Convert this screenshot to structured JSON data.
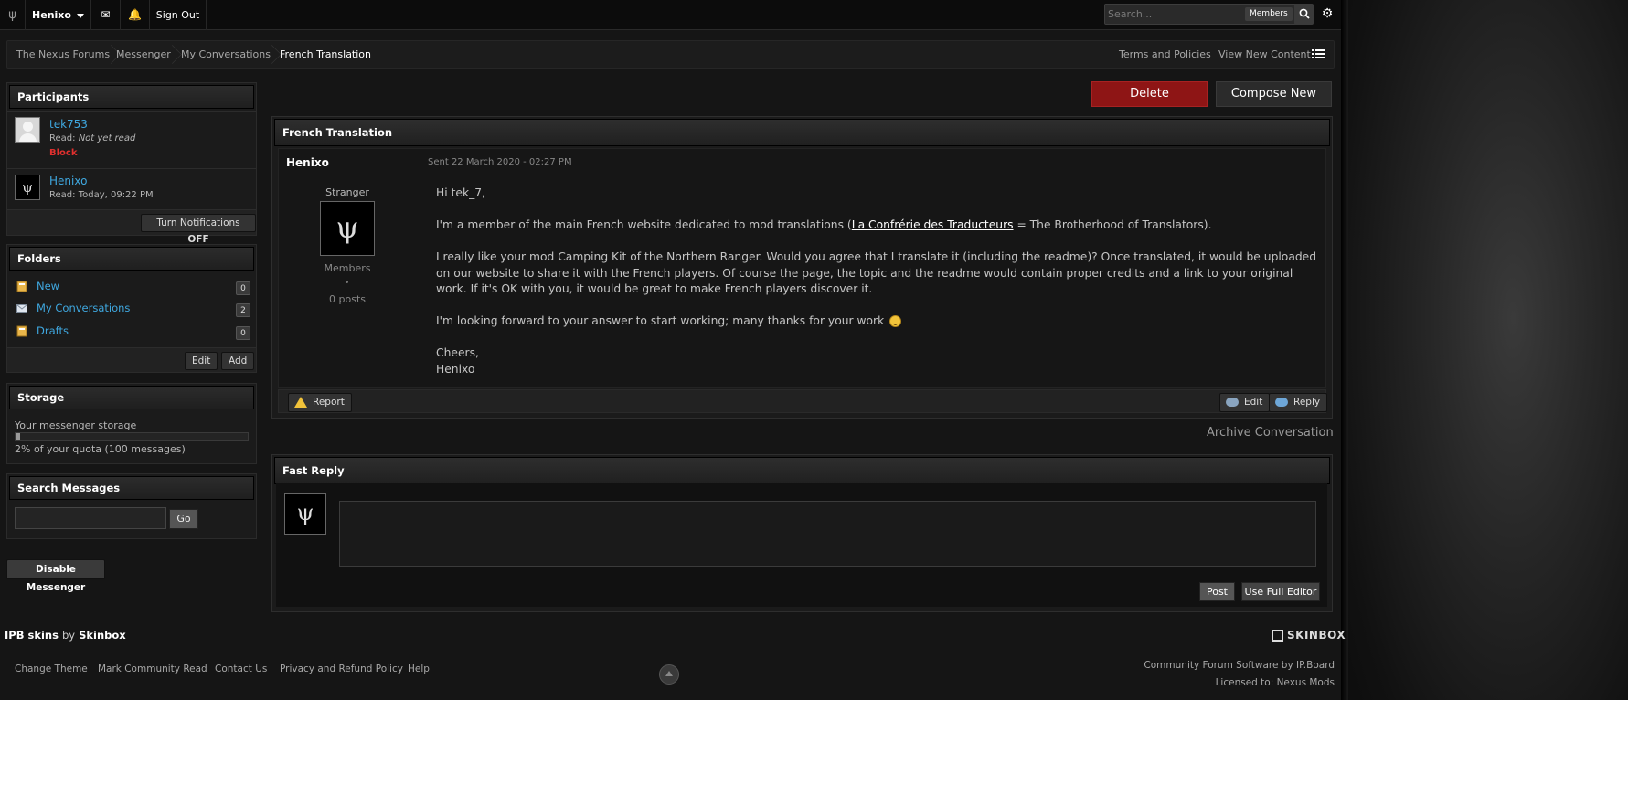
{
  "topbar": {
    "logo": "ψ",
    "user": "Henixo",
    "mail_icon": "✉",
    "bell_icon": "🔔",
    "sign_out": "Sign Out",
    "search_placeholder": "Search...",
    "search_scope": "Members",
    "search_icon": "search-icon",
    "settings_icon": "⚙"
  },
  "breadcrumb": {
    "items": [
      "The Nexus Forums",
      "Messenger",
      "My Conversations",
      "French Translation"
    ],
    "right_links": [
      "Terms and Policies",
      "View New Content"
    ]
  },
  "sidebar": {
    "participants": {
      "title": "Participants",
      "people": [
        {
          "name": "tek753",
          "read_label": "Read:",
          "read_value": "Not yet read",
          "block": "Block"
        },
        {
          "name": "Henixo",
          "read_label": "Read:",
          "read_value": "Today, 09:22 PM"
        }
      ],
      "notif_label": "Turn Notifications",
      "notif_state": "OFF"
    },
    "folders": {
      "title": "Folders",
      "items": [
        {
          "name": "New",
          "count": "0"
        },
        {
          "name": "My Conversations",
          "count": "2"
        },
        {
          "name": "Drafts",
          "count": "0"
        }
      ],
      "edit": "Edit",
      "add": "Add"
    },
    "storage": {
      "title": "Storage",
      "label": "Your messenger storage",
      "quota": "2% of your quota (100 messages)",
      "percent": 2
    },
    "search": {
      "title": "Search Messages",
      "go": "Go"
    },
    "disable": "Disable Messenger"
  },
  "actions": {
    "delete": "Delete",
    "compose": "Compose New"
  },
  "conversation": {
    "title": "French Translation",
    "author": "Henixo",
    "date": "Sent 22 March 2020 - 02:27 PM",
    "rank": "Stranger",
    "group": "Members",
    "posts": "0 posts",
    "body": {
      "greeting": "Hi tek_7,",
      "p1_before": "I'm a member of the main French website dedicated to mod translations (",
      "p1_link": "La Confrérie des Traducteurs",
      "p1_after": " = The Brotherhood of Translators).",
      "p2": "I really like your mod Camping Kit of the Northern Ranger. Would you agree that I translate it (including the readme)? Once translated, it would be uploaded on our website to share it with the French players. Of course the page, the topic and the readme would contain proper credits and a link to your original work. If it's OK with you, it would be great to make French players discover it.",
      "p3": "I'm looking forward to your answer to start working; many thanks for your work",
      "signoff1": "Cheers,",
      "signoff2": "Henixo"
    },
    "report": "Report",
    "edit": "Edit",
    "reply": "Reply",
    "archive": "Archive Conversation"
  },
  "fast_reply": {
    "title": "Fast Reply",
    "post": "Post",
    "full_editor": "Use Full Editor"
  },
  "footer": {
    "credit_a": "IPB skins",
    "credit_by": "by",
    "credit_b": "Skinbox",
    "brand": "SKINBOX",
    "links": [
      "Change Theme",
      "Mark Community Read",
      "Contact Us",
      "Privacy and Refund Policy",
      "Help"
    ],
    "software": "Community Forum Software by IP.Board",
    "license": "Licensed to: Nexus Mods"
  }
}
